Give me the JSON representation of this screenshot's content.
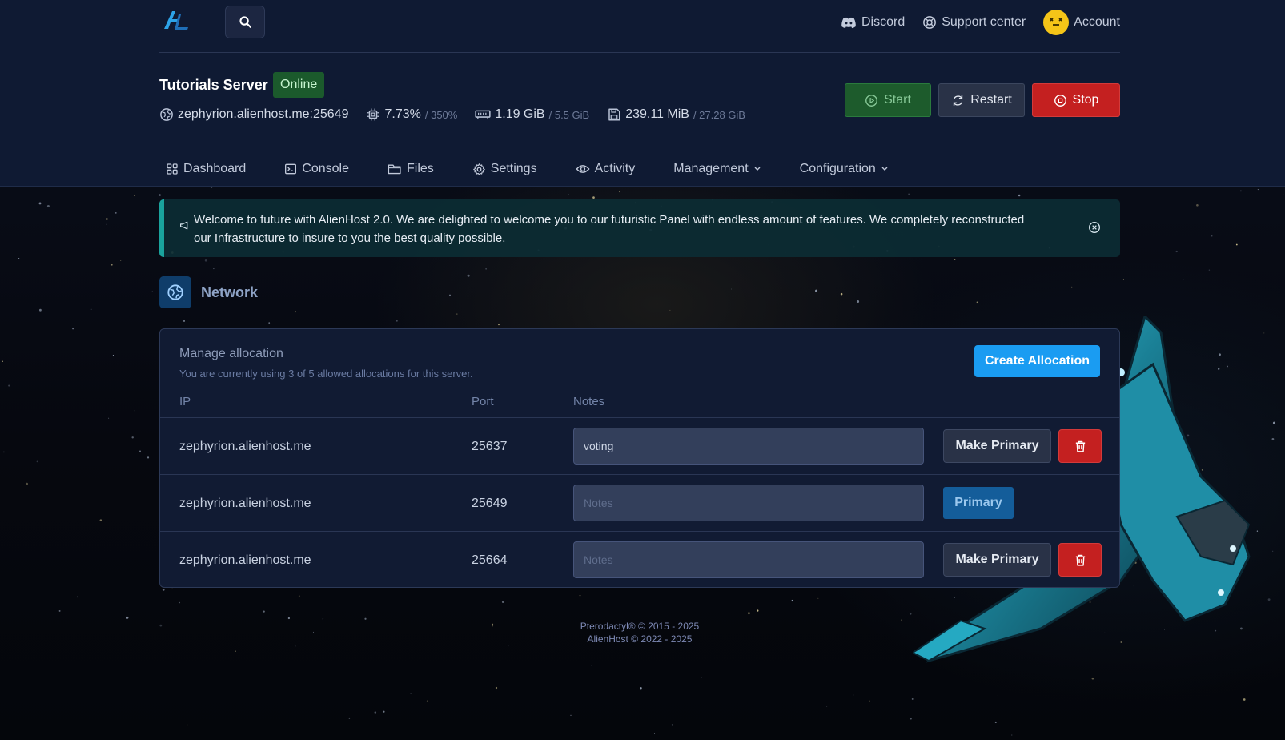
{
  "topbar": {
    "search_icon": "search-icon",
    "nav": [
      {
        "label": "Discord",
        "icon": "discord-icon"
      },
      {
        "label": "Support center",
        "icon": "lifebuoy-icon"
      },
      {
        "label": "Account",
        "icon": "avatar"
      }
    ]
  },
  "server": {
    "name": "Tutorials Server",
    "status": "Online",
    "address": "zephyrion.alienhost.me:25649",
    "cpu": "7.73%",
    "cpu_limit": "/ 350%",
    "memory": "1.19 GiB",
    "memory_limit": "/ 5.5 GiB",
    "disk": "239.11 MiB",
    "disk_limit": "/ 27.28 GiB"
  },
  "power": {
    "start": "Start",
    "restart": "Restart",
    "stop": "Stop"
  },
  "tabs": [
    {
      "label": "Dashboard",
      "icon": "grid-icon"
    },
    {
      "label": "Console",
      "icon": "terminal-icon"
    },
    {
      "label": "Files",
      "icon": "folder-icon"
    },
    {
      "label": "Settings",
      "icon": "gear-icon"
    },
    {
      "label": "Activity",
      "icon": "eye-icon"
    },
    {
      "label": "Management",
      "dropdown": true
    },
    {
      "label": "Configuration",
      "dropdown": true
    }
  ],
  "announcement": {
    "text": "Welcome to future with AlienHost 2.0. We are delighted to welcome you to our futuristic Panel with endless amount of features. We completely reconstructed our Infrastructure to insure to you the best quality possible."
  },
  "section": {
    "title": "Network"
  },
  "allocations": {
    "title": "Manage allocation",
    "subtitle": "You are currently using 3 of 5 allowed allocations for this server.",
    "create_label": "Create Allocation",
    "columns": [
      "IP",
      "Port",
      "Notes"
    ],
    "notes_placeholder": "Notes",
    "make_primary_label": "Make Primary",
    "primary_label": "Primary",
    "rows": [
      {
        "ip": "zephyrion.alienhost.me",
        "port": "25637",
        "notes": "voting",
        "primary": false
      },
      {
        "ip": "zephyrion.alienhost.me",
        "port": "25649",
        "notes": "",
        "primary": true
      },
      {
        "ip": "zephyrion.alienhost.me",
        "port": "25664",
        "notes": "",
        "primary": false
      }
    ]
  },
  "footer": {
    "line1": "Pterodactyl® © 2015 - 2025",
    "line2": "AlienHost © 2022 - 2025"
  },
  "colors": {
    "header_bg": "#0f1a33",
    "accent": "#1a9cf2",
    "success": "#1d5b2c",
    "danger": "#c42020",
    "announcement_border": "#1aa39d"
  }
}
